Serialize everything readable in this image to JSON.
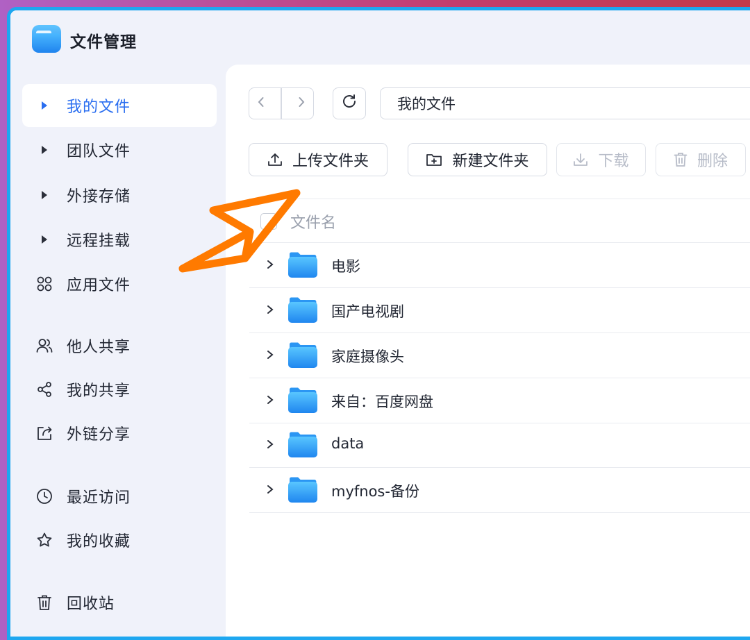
{
  "app": {
    "title": "文件管理"
  },
  "sidebar": {
    "items": [
      {
        "label": "我的文件",
        "icon": "caret-right-icon",
        "active": true
      },
      {
        "label": "团队文件",
        "icon": "caret-right-icon"
      },
      {
        "label": "外接存储",
        "icon": "caret-right-icon"
      },
      {
        "label": "远程挂载",
        "icon": "caret-right-icon"
      },
      {
        "label": "应用文件",
        "icon": "apps-grid-icon"
      },
      {
        "label": "他人共享",
        "icon": "users-icon"
      },
      {
        "label": "我的共享",
        "icon": "share-icon"
      },
      {
        "label": "外链分享",
        "icon": "external-share-icon"
      },
      {
        "label": "最近访问",
        "icon": "clock-icon"
      },
      {
        "label": "我的收藏",
        "icon": "star-icon"
      },
      {
        "label": "回收站",
        "icon": "trash-icon"
      }
    ]
  },
  "toolbar": {
    "path": "我的文件",
    "upload_label": "上传文件夹",
    "new_folder_label": "新建文件夹",
    "download_label": "下载",
    "delete_label": "删除"
  },
  "table": {
    "header_name": "文件名",
    "rows": [
      {
        "name": "电影"
      },
      {
        "name": "国产电视剧"
      },
      {
        "name": "家庭摄像头"
      },
      {
        "name": "来自：百度网盘"
      },
      {
        "name": "data"
      },
      {
        "name": "myfnos-备份"
      }
    ]
  },
  "colors": {
    "accent": "#2a6ef0",
    "frame": "#1ea7f0",
    "arrow": "#ff7a00"
  }
}
